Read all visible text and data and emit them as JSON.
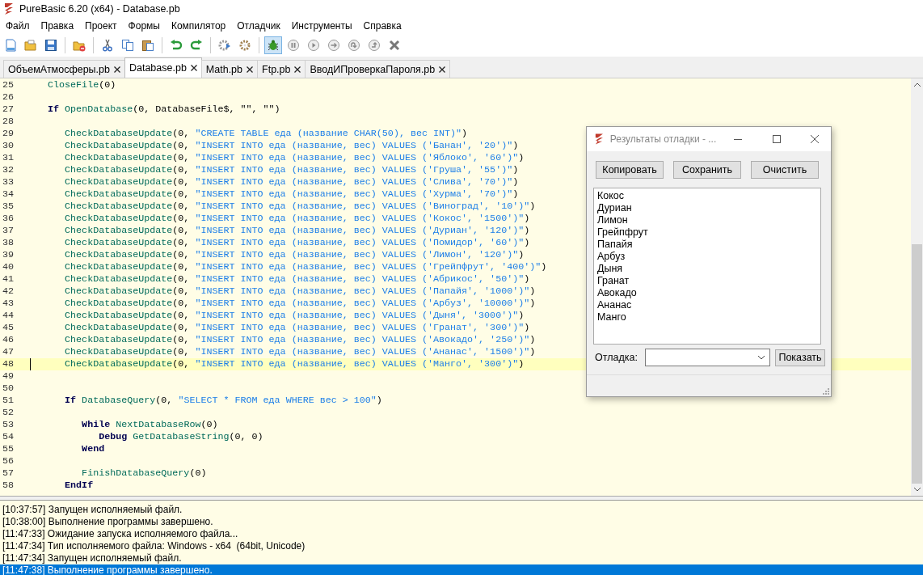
{
  "window": {
    "title": "PureBasic 6.20 (x64) - Database.pb"
  },
  "menu": [
    "Файл",
    "Правка",
    "Проект",
    "Формы",
    "Компилятор",
    "Отладчик",
    "Инструменты",
    "Справка"
  ],
  "toolbar": {
    "debugger_enabled": true
  },
  "tabs": [
    {
      "label": "ОбъемАтмосферы.pb",
      "selected": false
    },
    {
      "label": "Database.pb",
      "selected": true
    },
    {
      "label": "Math.pb",
      "selected": false
    },
    {
      "label": "Ftp.pb",
      "selected": false
    },
    {
      "label": "ВводИПроверкаПароля.pb",
      "selected": false
    }
  ],
  "editor": {
    "lines": [
      {
        "number": "25",
        "current": false,
        "tokens": [
          {
            "kind": "fn",
            "text": "   CloseFile"
          },
          {
            "kind": "txt",
            "text": "(0)"
          }
        ]
      },
      {
        "number": "26",
        "current": false
      },
      {
        "number": "27",
        "current": false,
        "tokens": [
          {
            "kind": "kw",
            "text": "   If"
          },
          {
            "kind": "fn",
            "text": " OpenDatabase"
          },
          {
            "kind": "txt",
            "text": "(0, DatabaseFile$, \"\", \"\")"
          }
        ]
      },
      {
        "number": "28",
        "current": false
      },
      {
        "number": "29",
        "current": false,
        "tokens": [
          {
            "kind": "fn",
            "text": "      CheckDatabaseUpdate"
          },
          {
            "kind": "txt",
            "text": "(0, "
          },
          {
            "kind": "str",
            "text": "\"CREATE TABLE еда (название CHAR(50), вес INT)\""
          },
          {
            "kind": "txt",
            "text": ")"
          }
        ]
      },
      {
        "number": "30",
        "current": false,
        "tokens": [
          {
            "kind": "fn",
            "text": "      CheckDatabaseUpdate"
          },
          {
            "kind": "txt",
            "text": "(0, "
          },
          {
            "kind": "str",
            "text": "\"INSERT INTO еда (название, вес) VALUES ('Банан', '20')\""
          },
          {
            "kind": "txt",
            "text": ")"
          }
        ]
      },
      {
        "number": "31",
        "current": false,
        "tokens": [
          {
            "kind": "fn",
            "text": "      CheckDatabaseUpdate"
          },
          {
            "kind": "txt",
            "text": "(0, "
          },
          {
            "kind": "str",
            "text": "\"INSERT INTO еда (название, вес) VALUES ('Яблоко', '60')\""
          },
          {
            "kind": "txt",
            "text": ")"
          }
        ]
      },
      {
        "number": "32",
        "current": false,
        "tokens": [
          {
            "kind": "fn",
            "text": "      CheckDatabaseUpdate"
          },
          {
            "kind": "txt",
            "text": "(0, "
          },
          {
            "kind": "str",
            "text": "\"INSERT INTO еда (название, вес) VALUES ('Груша', '55')\""
          },
          {
            "kind": "txt",
            "text": ")"
          }
        ]
      },
      {
        "number": "33",
        "current": false,
        "tokens": [
          {
            "kind": "fn",
            "text": "      CheckDatabaseUpdate"
          },
          {
            "kind": "txt",
            "text": "(0, "
          },
          {
            "kind": "str",
            "text": "\"INSERT INTO еда (название, вес) VALUES ('Слива', '70')\""
          },
          {
            "kind": "txt",
            "text": ")"
          }
        ]
      },
      {
        "number": "34",
        "current": false,
        "tokens": [
          {
            "kind": "fn",
            "text": "      CheckDatabaseUpdate"
          },
          {
            "kind": "txt",
            "text": "(0, "
          },
          {
            "kind": "str",
            "text": "\"INSERT INTO еда (название, вес) VALUES ('Хурма', '70')\""
          },
          {
            "kind": "txt",
            "text": ")"
          }
        ]
      },
      {
        "number": "35",
        "current": false,
        "tokens": [
          {
            "kind": "fn",
            "text": "      CheckDatabaseUpdate"
          },
          {
            "kind": "txt",
            "text": "(0, "
          },
          {
            "kind": "str",
            "text": "\"INSERT INTO еда (название, вес) VALUES ('Виноград', '10')\""
          },
          {
            "kind": "txt",
            "text": ")"
          }
        ]
      },
      {
        "number": "36",
        "current": false,
        "tokens": [
          {
            "kind": "fn",
            "text": "      CheckDatabaseUpdate"
          },
          {
            "kind": "txt",
            "text": "(0, "
          },
          {
            "kind": "str",
            "text": "\"INSERT INTO еда (название, вес) VALUES ('Кокос', '1500')\""
          },
          {
            "kind": "txt",
            "text": ")"
          }
        ]
      },
      {
        "number": "37",
        "current": false,
        "tokens": [
          {
            "kind": "fn",
            "text": "      CheckDatabaseUpdate"
          },
          {
            "kind": "txt",
            "text": "(0, "
          },
          {
            "kind": "str",
            "text": "\"INSERT INTO еда (название, вес) VALUES ('Дуриан', '120')\""
          },
          {
            "kind": "txt",
            "text": ")"
          }
        ]
      },
      {
        "number": "38",
        "current": false,
        "tokens": [
          {
            "kind": "fn",
            "text": "      CheckDatabaseUpdate"
          },
          {
            "kind": "txt",
            "text": "(0, "
          },
          {
            "kind": "str",
            "text": "\"INSERT INTO еда (название, вес) VALUES ('Помидор', '60')\""
          },
          {
            "kind": "txt",
            "text": ")"
          }
        ]
      },
      {
        "number": "39",
        "current": false,
        "tokens": [
          {
            "kind": "fn",
            "text": "      CheckDatabaseUpdate"
          },
          {
            "kind": "txt",
            "text": "(0, "
          },
          {
            "kind": "str",
            "text": "\"INSERT INTO еда (название, вес) VALUES ('Лимон', '120')\""
          },
          {
            "kind": "txt",
            "text": ")"
          }
        ]
      },
      {
        "number": "40",
        "current": false,
        "tokens": [
          {
            "kind": "fn",
            "text": "      CheckDatabaseUpdate"
          },
          {
            "kind": "txt",
            "text": "(0, "
          },
          {
            "kind": "str",
            "text": "\"INSERT INTO еда (название, вес) VALUES ('Грейпфрут', '400')\""
          },
          {
            "kind": "txt",
            "text": ")"
          }
        ]
      },
      {
        "number": "41",
        "current": false,
        "tokens": [
          {
            "kind": "fn",
            "text": "      CheckDatabaseUpdate"
          },
          {
            "kind": "txt",
            "text": "(0, "
          },
          {
            "kind": "str",
            "text": "\"INSERT INTO еда (название, вес) VALUES ('Абрикос', '50')\""
          },
          {
            "kind": "txt",
            "text": ")"
          }
        ]
      },
      {
        "number": "42",
        "current": false,
        "tokens": [
          {
            "kind": "fn",
            "text": "      CheckDatabaseUpdate"
          },
          {
            "kind": "txt",
            "text": "(0, "
          },
          {
            "kind": "str",
            "text": "\"INSERT INTO еда (название, вес) VALUES ('Папайя', '1000')\""
          },
          {
            "kind": "txt",
            "text": ")"
          }
        ]
      },
      {
        "number": "43",
        "current": false,
        "tokens": [
          {
            "kind": "fn",
            "text": "      CheckDatabaseUpdate"
          },
          {
            "kind": "txt",
            "text": "(0, "
          },
          {
            "kind": "str",
            "text": "\"INSERT INTO еда (название, вес) VALUES ('Арбуз', '10000')\""
          },
          {
            "kind": "txt",
            "text": ")"
          }
        ]
      },
      {
        "number": "44",
        "current": false,
        "tokens": [
          {
            "kind": "fn",
            "text": "      CheckDatabaseUpdate"
          },
          {
            "kind": "txt",
            "text": "(0, "
          },
          {
            "kind": "str",
            "text": "\"INSERT INTO еда (название, вес) VALUES ('Дыня', '3000')\""
          },
          {
            "kind": "txt",
            "text": ")"
          }
        ]
      },
      {
        "number": "45",
        "current": false,
        "tokens": [
          {
            "kind": "fn",
            "text": "      CheckDatabaseUpdate"
          },
          {
            "kind": "txt",
            "text": "(0, "
          },
          {
            "kind": "str",
            "text": "\"INSERT INTO еда (название, вес) VALUES ('Гранат', '300')\""
          },
          {
            "kind": "txt",
            "text": ")"
          }
        ]
      },
      {
        "number": "46",
        "current": false,
        "tokens": [
          {
            "kind": "fn",
            "text": "      CheckDatabaseUpdate"
          },
          {
            "kind": "txt",
            "text": "(0, "
          },
          {
            "kind": "str",
            "text": "\"INSERT INTO еда (название, вес) VALUES ('Авокадо', '250')\""
          },
          {
            "kind": "txt",
            "text": ")"
          }
        ]
      },
      {
        "number": "47",
        "current": false,
        "tokens": [
          {
            "kind": "fn",
            "text": "      CheckDatabaseUpdate"
          },
          {
            "kind": "txt",
            "text": "(0, "
          },
          {
            "kind": "str",
            "text": "\"INSERT INTO еда (название, вес) VALUES ('Ананас', '1500')\""
          },
          {
            "kind": "txt",
            "text": ")"
          }
        ]
      },
      {
        "number": "48",
        "current": true,
        "tokens": [
          {
            "kind": "fn",
            "text": "      CheckDatabaseUpdate"
          },
          {
            "kind": "txt",
            "text": "(0, "
          },
          {
            "kind": "str",
            "text": "\"INSERT INTO еда (название, вес) VALUES ('Манго', '300')\""
          },
          {
            "kind": "txt",
            "text": ")"
          }
        ]
      },
      {
        "number": "49",
        "current": false
      },
      {
        "number": "50",
        "current": false
      },
      {
        "number": "51",
        "current": false,
        "tokens": [
          {
            "kind": "kw",
            "text": "      If"
          },
          {
            "kind": "fn",
            "text": " DatabaseQuery"
          },
          {
            "kind": "txt",
            "text": "(0, "
          },
          {
            "kind": "str",
            "text": "\"SELECT * FROM еда WHERE вес > 100\""
          },
          {
            "kind": "txt",
            "text": ")"
          }
        ]
      },
      {
        "number": "52",
        "current": false
      },
      {
        "number": "53",
        "current": false,
        "tokens": [
          {
            "kind": "kw",
            "text": "         While"
          },
          {
            "kind": "fn",
            "text": " NextDatabaseRow"
          },
          {
            "kind": "txt",
            "text": "(0)"
          }
        ]
      },
      {
        "number": "54",
        "current": false,
        "tokens": [
          {
            "kind": "kw",
            "text": "            Debug"
          },
          {
            "kind": "fn",
            "text": " GetDatabaseString"
          },
          {
            "kind": "txt",
            "text": "(0, 0)"
          }
        ]
      },
      {
        "number": "55",
        "current": false,
        "tokens": [
          {
            "kind": "kw",
            "text": "         Wend"
          }
        ]
      },
      {
        "number": "56",
        "current": false
      },
      {
        "number": "57",
        "current": false,
        "tokens": [
          {
            "kind": "fn",
            "text": "         FinishDatabaseQuery"
          },
          {
            "kind": "txt",
            "text": "(0)"
          }
        ]
      },
      {
        "number": "58",
        "current": false,
        "tokens": [
          {
            "kind": "kw",
            "text": "      EndIf"
          }
        ]
      }
    ]
  },
  "debug_window": {
    "title": "Результаты отладки - ...",
    "buttons": [
      "Копировать",
      "Сохранить",
      "Очистить"
    ],
    "output": [
      "Кокос",
      "Дуриан",
      "Лимон",
      "Грейпфрут",
      "Папайя",
      "Арбуз",
      "Дыня",
      "Гранат",
      "Авокадо",
      "Ананас",
      "Манго"
    ],
    "debug_label": "Отладка:",
    "show_button": "Показать"
  },
  "log": [
    {
      "text": "[10:37:57] Запущен исполняемый файл.",
      "selected": false
    },
    {
      "text": "[10:38:00] Выполнение программы завершено.",
      "selected": false
    },
    {
      "text": "[11:47:33] Ожидание запуска исполняемого файла...",
      "selected": false
    },
    {
      "text": "[11:47:34] Тип исполняемого файла: Windows - x64  (64bit, Unicode)",
      "selected": false
    },
    {
      "text": "[11:47:34] Запущен исполняемый файл.",
      "selected": false
    },
    {
      "text": "[11:47:38] Выполнение программы завершено.",
      "selected": true
    }
  ]
}
